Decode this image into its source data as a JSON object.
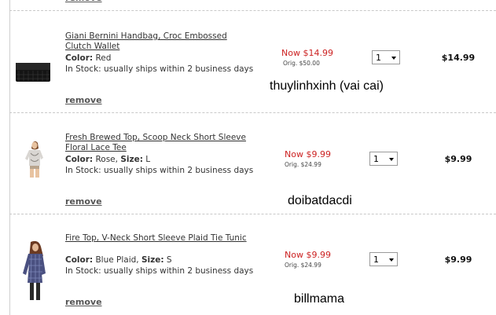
{
  "previous_row": {
    "remove_label": "remove"
  },
  "items": [
    {
      "name": "Giani Bernini Handbag, Croc Embossed Clutch Wallet",
      "color_label": "Color:",
      "color_value": "Red",
      "size_label": "",
      "size_value": "",
      "stock": "In Stock: usually ships within 2 business days",
      "remove_label": "remove",
      "price_now": "Now $14.99",
      "price_orig": "Orig. $50.00",
      "qty": "1",
      "total": "$14.99",
      "overlay_text": "thuylinhxinh (vai cai)",
      "thumb_icon": "clutch-wallet-image"
    },
    {
      "name": "Fresh Brewed Top, Scoop Neck Short Sleeve Floral Lace Tee",
      "color_label": "Color:",
      "color_value": "Rose,",
      "size_label": "Size:",
      "size_value": "L",
      "stock": "In Stock: usually ships within 2 business days",
      "remove_label": "remove",
      "price_now": "Now $9.99",
      "price_orig": "Orig. $24.99",
      "qty": "1",
      "total": "$9.99",
      "overlay_text": "doibatdacdi",
      "thumb_icon": "lace-tee-image"
    },
    {
      "name": "Fire Top, V-Neck Short Sleeve Plaid Tie Tunic",
      "color_label": "Color:",
      "color_value": "Blue Plaid,",
      "size_label": "Size:",
      "size_value": "S",
      "stock": "In Stock: usually ships within 2 business days",
      "remove_label": "remove",
      "price_now": "Now $9.99",
      "price_orig": "Orig. $24.99",
      "qty": "1",
      "total": "$9.99",
      "overlay_text": "billmama",
      "thumb_icon": "plaid-tunic-image"
    }
  ],
  "colors": {
    "sale_price": "#cc2222",
    "text": "#333333",
    "separator": "#c8c8c8"
  }
}
